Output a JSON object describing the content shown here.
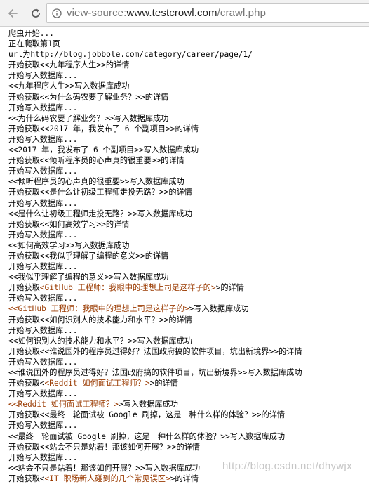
{
  "browser": {
    "url_scheme": "view-source:",
    "url_host": "www.testcrowl.com",
    "url_path": "/crawl.php",
    "icons": [
      "back-arrow-icon",
      "reload-icon",
      "page-info-icon"
    ]
  },
  "source_lines": [
    [
      {
        "t": "爬虫开始..."
      }
    ],
    [
      {
        "t": "正在爬取第1页"
      }
    ],
    [
      {
        "t": "url为http://blog.jobbole.com/category/career/page/1/"
      }
    ],
    [
      {
        "t": "开始获取<<九年程序人生>>的详情"
      }
    ],
    [
      {
        "t": "开始写入数据库..."
      }
    ],
    [
      {
        "t": "<<九年程序人生>>写入数据库成功"
      }
    ],
    [
      {
        "t": "开始获取<<为什么码农要了解业务？>>的详情"
      }
    ],
    [
      {
        "t": "开始写入数据库..."
      }
    ],
    [
      {
        "t": "<<为什么码农要了解业务？>>写入数据库成功"
      }
    ],
    [
      {
        "t": "开始获取<<2017 年，我发布了 6 个副项目>>的详情"
      }
    ],
    [
      {
        "t": "开始写入数据库..."
      }
    ],
    [
      {
        "t": "<<2017 年，我发布了 6 个副项目>>写入数据库成功"
      }
    ],
    [
      {
        "t": "开始获取<<倾听程序员的心声真的很重要>>的详情"
      }
    ],
    [
      {
        "t": "开始写入数据库..."
      }
    ],
    [
      {
        "t": "<<倾听程序员的心声真的很重要>>写入数据库成功"
      }
    ],
    [
      {
        "t": "开始获取<<是什么让初级工程师走投无路？>>的详情"
      }
    ],
    [
      {
        "t": "开始写入数据库..."
      }
    ],
    [
      {
        "t": "<<是什么让初级工程师走投无路？>>写入数据库成功"
      }
    ],
    [
      {
        "t": "开始获取<<如何高效学习>>的详情"
      }
    ],
    [
      {
        "t": "开始写入数据库..."
      }
    ],
    [
      {
        "t": "<<如何高效学习>>写入数据库成功"
      }
    ],
    [
      {
        "t": "开始获取<<我似乎理解了编程的意义>>的详情"
      }
    ],
    [
      {
        "t": "开始写入数据库..."
      }
    ],
    [
      {
        "t": "<<我似乎理解了编程的意义>>写入数据库成功"
      }
    ],
    [
      {
        "t": "开始获取"
      },
      {
        "t": "<GitHub 工程师：我眼中的理想上司是这样子的>",
        "hl": true
      },
      {
        "t": ">的详情"
      }
    ],
    [
      {
        "t": "开始写入数据库..."
      }
    ],
    [
      {
        "t": "<<GitHub 工程师：我眼中的理想上司是这样子的>",
        "hl": true
      },
      {
        "t": ">写入数据库成功"
      }
    ],
    [
      {
        "t": "开始获取<<如何识别人的技术能力和水平？>>的详情"
      }
    ],
    [
      {
        "t": "开始写入数据库..."
      }
    ],
    [
      {
        "t": "<<如何识别人的技术能力和水平？>>写入数据库成功"
      }
    ],
    [
      {
        "t": "开始获取<<谁说国外的程序员过得好？法国政府搞的软件项目，坑出新境界>>的详情"
      }
    ],
    [
      {
        "t": "开始写入数据库..."
      }
    ],
    [
      {
        "t": "<<谁说国外的程序员过得好？法国政府搞的软件项目，坑出新境界>>写入数据库成功"
      }
    ],
    [
      {
        "t": "开始获取<"
      },
      {
        "t": "<Reddit 如何面试工程师？>",
        "hl": true
      },
      {
        "t": ">的详情"
      }
    ],
    [
      {
        "t": "开始写入数据库..."
      }
    ],
    [
      {
        "t": "<<Reddit 如何面试工程师？>",
        "hl": true
      },
      {
        "t": ">写入数据库成功"
      }
    ],
    [
      {
        "t": "开始获取<<最终一轮面试被 Google 刷掉，这是一种什么样的体验？>>的详情"
      }
    ],
    [
      {
        "t": "开始写入数据库..."
      }
    ],
    [
      {
        "t": "<<最终一轮面试被 Google 刷掉，这是一种什么样的体验？>>写入数据库成功"
      }
    ],
    [
      {
        "t": "开始获取<<站会不只是站着！那该如何开展？>>的详情"
      }
    ],
    [
      {
        "t": "开始写入数据库..."
      }
    ],
    [
      {
        "t": "<<站会不只是站着！那该如何开展？>>写入数据库成功"
      }
    ],
    [
      {
        "t": "开始获取<"
      },
      {
        "t": "<IT 职场新人碰到的几个常见误区>",
        "hl": true
      },
      {
        "t": ">的详情"
      }
    ]
  ],
  "watermark": "http://blog.csdn.net/dhywjx",
  "colors": {
    "text": "#000000",
    "highlight_text": "#9a3a00",
    "toolbar_bg": "#f2f2f2",
    "url_dim": "#777777",
    "url_host": "#222222"
  }
}
